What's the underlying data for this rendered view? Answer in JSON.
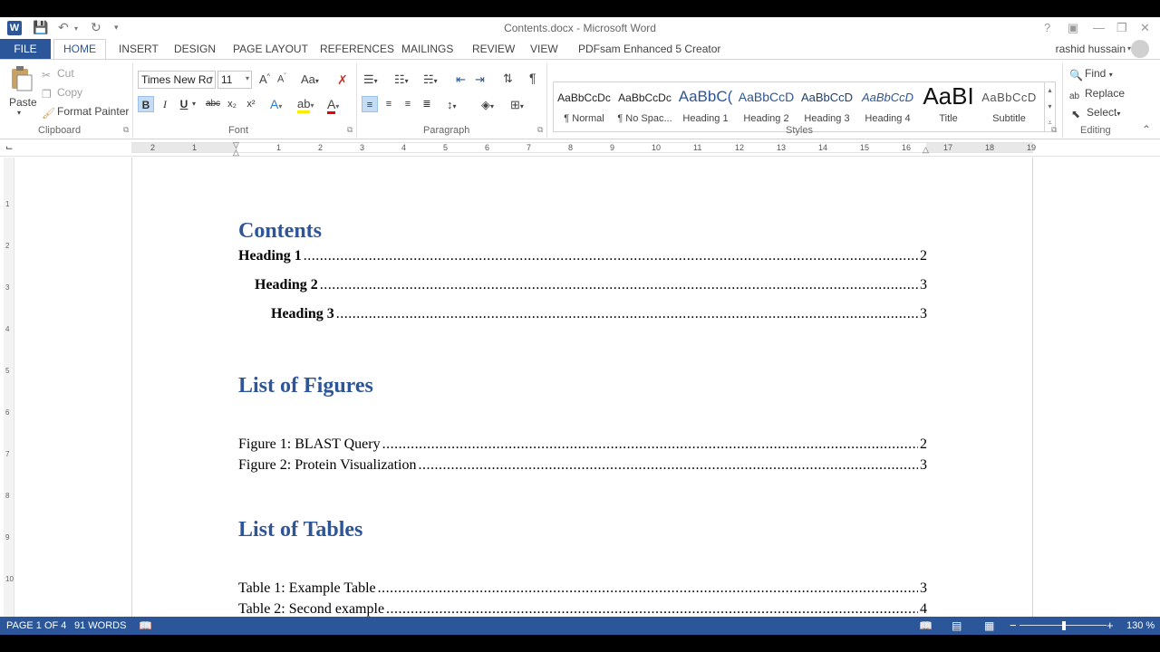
{
  "window": {
    "title": "Contents.docx - Microsoft Word",
    "user": "rashid hussain"
  },
  "tabs": [
    "FILE",
    "HOME",
    "INSERT",
    "DESIGN",
    "PAGE LAYOUT",
    "REFERENCES",
    "MAILINGS",
    "REVIEW",
    "VIEW",
    "PDFsam Enhanced 5 Creator"
  ],
  "clipboard": {
    "paste": "Paste",
    "cut": "Cut",
    "copy": "Copy",
    "format_painter": "Format Painter",
    "label": "Clipboard"
  },
  "font": {
    "name": "Times New Ro",
    "size": "11",
    "label": "Font",
    "bold": "B",
    "italic": "I",
    "underline": "U",
    "strike": "abc",
    "sub": "x₂",
    "sup": "x²"
  },
  "paragraph": {
    "label": "Paragraph"
  },
  "styles": {
    "label": "Styles",
    "items": [
      {
        "preview": "AaBbCcDc",
        "name": "¶ Normal"
      },
      {
        "preview": "AaBbCcDc",
        "name": "¶ No Spac..."
      },
      {
        "preview": "AaBbC(",
        "name": "Heading 1"
      },
      {
        "preview": "AaBbCcD",
        "name": "Heading 2"
      },
      {
        "preview": "AaBbCcD",
        "name": "Heading 3"
      },
      {
        "preview": "AaBbCcD",
        "name": "Heading 4"
      },
      {
        "preview": "AaBI",
        "name": "Title"
      },
      {
        "preview": "AaBbCcD",
        "name": "Subtitle"
      }
    ]
  },
  "editing": {
    "find": "Find",
    "replace": "Replace",
    "select": "Select",
    "label": "Editing"
  },
  "ruler_numbers": [
    "2",
    "1",
    "1",
    "2",
    "3",
    "4",
    "5",
    "6",
    "7",
    "8",
    "9",
    "10",
    "11",
    "12",
    "13",
    "14",
    "15",
    "16",
    "17",
    "18",
    "19"
  ],
  "vruler_numbers": [
    "1",
    "2",
    "3",
    "4",
    "5",
    "6",
    "7",
    "8",
    "9",
    "10"
  ],
  "document": {
    "contents_heading": "Contents",
    "toc": [
      {
        "text": "Heading 1",
        "page": "2"
      },
      {
        "text": "Heading 2",
        "page": "3"
      },
      {
        "text": "Heading 3",
        "page": "3"
      }
    ],
    "figures_heading": "List of Figures",
    "figures": [
      {
        "text": "Figure 1: BLAST Query",
        "page": "2"
      },
      {
        "text": "Figure 2: Protein Visualization",
        "page": "3"
      }
    ],
    "tables_heading": "List of Tables",
    "tables": [
      {
        "text": "Table 1: Example Table",
        "page": "3"
      },
      {
        "text": "Table 2: Second example",
        "page": "4"
      }
    ]
  },
  "status": {
    "page": "PAGE 1 OF 4",
    "words": "91 WORDS",
    "zoom": "130 %"
  },
  "colors": {
    "accent": "#2b579a",
    "heading": "#2e5597"
  }
}
